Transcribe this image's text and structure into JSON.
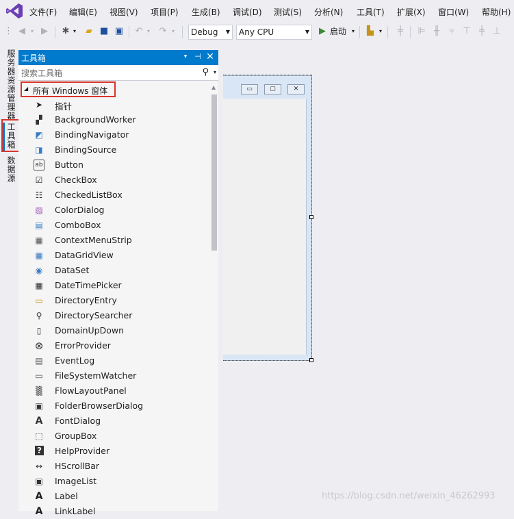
{
  "menubar": {
    "logo_icon": "visual-studio-logo-icon",
    "items": [
      "文件(F)",
      "编辑(E)",
      "视图(V)",
      "项目(P)",
      "生成(B)",
      "调试(D)",
      "测试(S)",
      "分析(N)",
      "工具(T)",
      "扩展(X)",
      "窗口(W)",
      "帮助(H)"
    ]
  },
  "toolbar": {
    "configuration": "Debug",
    "platform": "Any CPU",
    "start_label": "启动"
  },
  "side_tabs": {
    "server_explorer": "服务器资源管理器",
    "toolbox": "工具箱",
    "data_sources": "数据源"
  },
  "toolbox": {
    "title": "工具箱",
    "search_placeholder": "搜索工具箱",
    "group_label": "所有 Windows 窗体",
    "items": [
      {
        "label": "指针",
        "icon": "pointer-icon"
      },
      {
        "label": "BackgroundWorker",
        "icon": "background-worker-icon"
      },
      {
        "label": "BindingNavigator",
        "icon": "binding-navigator-icon"
      },
      {
        "label": "BindingSource",
        "icon": "binding-source-icon"
      },
      {
        "label": "Button",
        "icon": "button-icon"
      },
      {
        "label": "CheckBox",
        "icon": "checkbox-icon"
      },
      {
        "label": "CheckedListBox",
        "icon": "checked-list-box-icon"
      },
      {
        "label": "ColorDialog",
        "icon": "color-dialog-icon"
      },
      {
        "label": "ComboBox",
        "icon": "combo-box-icon"
      },
      {
        "label": "ContextMenuStrip",
        "icon": "context-menu-strip-icon"
      },
      {
        "label": "DataGridView",
        "icon": "data-grid-view-icon"
      },
      {
        "label": "DataSet",
        "icon": "data-set-icon"
      },
      {
        "label": "DateTimePicker",
        "icon": "date-time-picker-icon"
      },
      {
        "label": "DirectoryEntry",
        "icon": "directory-entry-icon"
      },
      {
        "label": "DirectorySearcher",
        "icon": "directory-searcher-icon"
      },
      {
        "label": "DomainUpDown",
        "icon": "domain-up-down-icon"
      },
      {
        "label": "ErrorProvider",
        "icon": "error-provider-icon"
      },
      {
        "label": "EventLog",
        "icon": "event-log-icon"
      },
      {
        "label": "FileSystemWatcher",
        "icon": "file-system-watcher-icon"
      },
      {
        "label": "FlowLayoutPanel",
        "icon": "flow-layout-panel-icon"
      },
      {
        "label": "FolderBrowserDialog",
        "icon": "folder-browser-dialog-icon"
      },
      {
        "label": "FontDialog",
        "icon": "font-dialog-icon"
      },
      {
        "label": "GroupBox",
        "icon": "group-box-icon"
      },
      {
        "label": "HelpProvider",
        "icon": "help-provider-icon"
      },
      {
        "label": "HScrollBar",
        "icon": "hscrollbar-icon"
      },
      {
        "label": "ImageList",
        "icon": "image-list-icon"
      },
      {
        "label": "Label",
        "icon": "label-icon"
      },
      {
        "label": "LinkLabel",
        "icon": "link-label-icon"
      }
    ]
  },
  "watermark": "https://blog.csdn.net/weixin_46262993",
  "colors": {
    "accent": "#007acc",
    "highlight_box": "#d9342b"
  }
}
